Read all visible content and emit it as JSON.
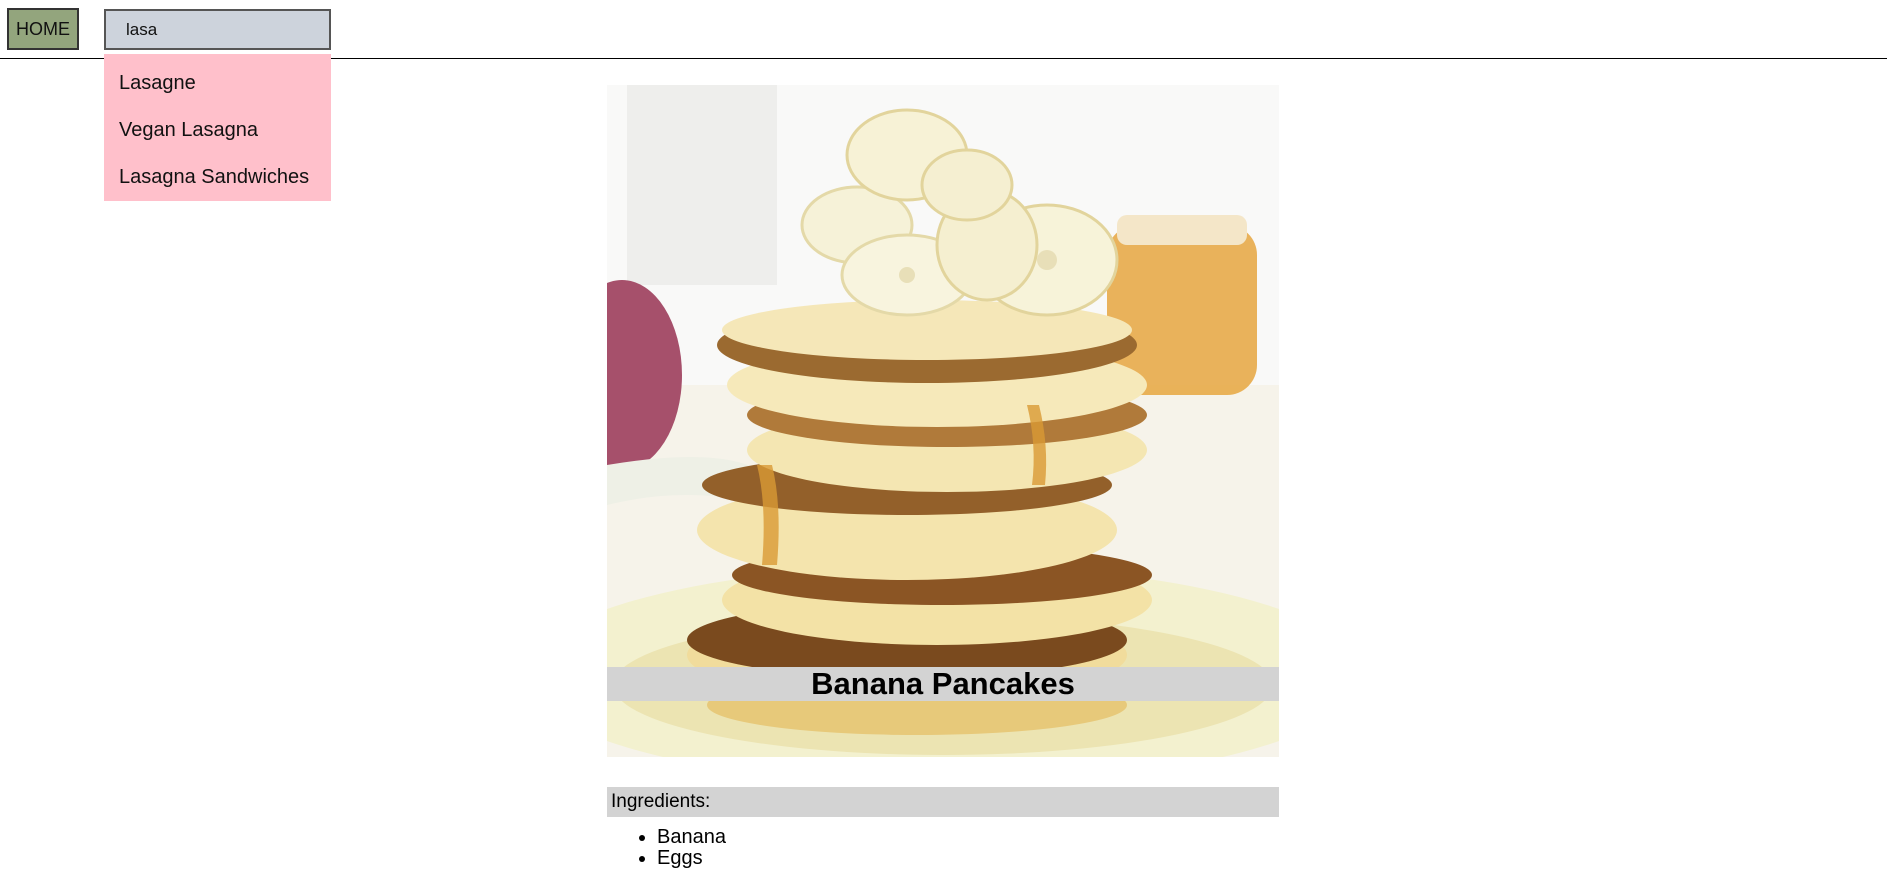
{
  "header": {
    "home_label": "HOME",
    "search_value": "lasa",
    "suggestions": [
      "Lasagne",
      "Vegan Lasagna",
      "Lasagna Sandwiches"
    ]
  },
  "recipe": {
    "image_subject": "stack of banana pancakes with honey",
    "title": "Banana Pancakes",
    "ingredients_heading": "Ingredients:",
    "ingredients": [
      "Banana",
      "Eggs"
    ]
  },
  "colors": {
    "home_button": "#93a57d",
    "search_background": "#cdd3dc",
    "suggestions_background": "#ffc0cb",
    "caption_band": "#d3d3d3"
  }
}
